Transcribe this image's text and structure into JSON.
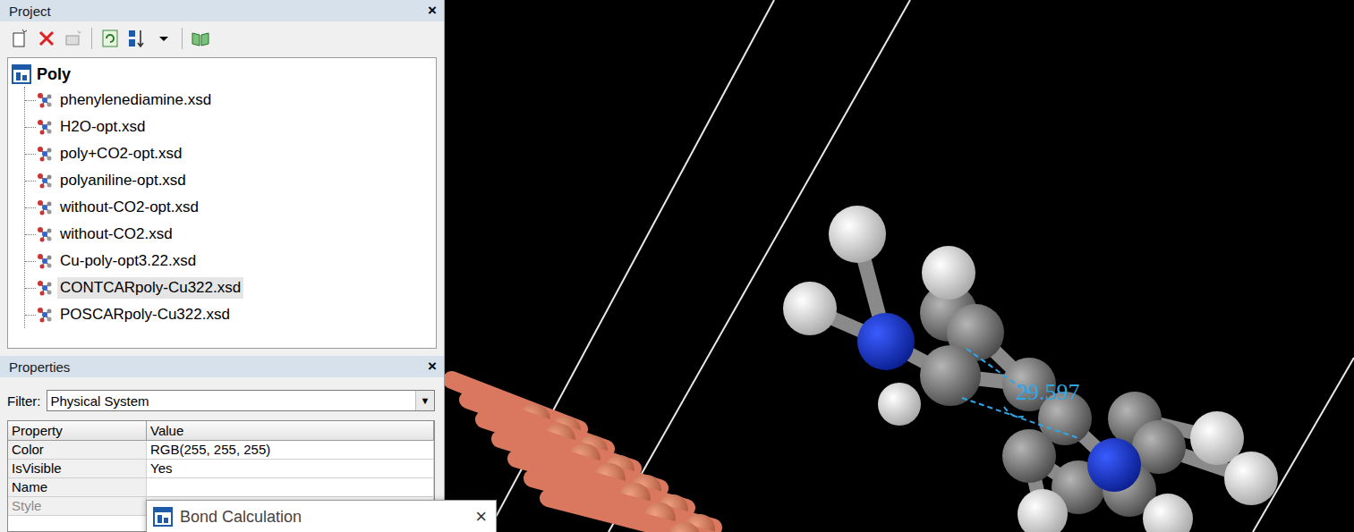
{
  "project_panel": {
    "title": "Project",
    "close": "×"
  },
  "tree": {
    "root": "Poly",
    "items": [
      {
        "label": "phenylenediamine.xsd",
        "selected": false
      },
      {
        "label": "H2O-opt.xsd",
        "selected": false
      },
      {
        "label": "poly+CO2-opt.xsd",
        "selected": false
      },
      {
        "label": "polyaniline-opt.xsd",
        "selected": false
      },
      {
        "label": "without-CO2-opt.xsd",
        "selected": false
      },
      {
        "label": "without-CO2.xsd",
        "selected": false
      },
      {
        "label": "Cu-poly-opt3.22.xsd",
        "selected": false
      },
      {
        "label": "CONTCARpoly-Cu322.xsd",
        "selected": true
      },
      {
        "label": "POSCARpoly-Cu322.xsd",
        "selected": false
      }
    ]
  },
  "properties_panel": {
    "title": "Properties",
    "close": "×",
    "filter_label": "Filter:",
    "filter_value": "Physical System",
    "columns": [
      "Property",
      "Value"
    ],
    "rows": [
      {
        "property": "Color",
        "value": "RGB(255, 255, 255)",
        "disabled": false
      },
      {
        "property": "IsVisible",
        "value": "Yes",
        "disabled": false
      },
      {
        "property": "Name",
        "value": "",
        "disabled": false
      },
      {
        "property": "Style",
        "value": "",
        "disabled": true
      }
    ]
  },
  "viewer": {
    "measurement": "29.597"
  },
  "dialog": {
    "title": "Bond Calculation",
    "close": "×"
  }
}
